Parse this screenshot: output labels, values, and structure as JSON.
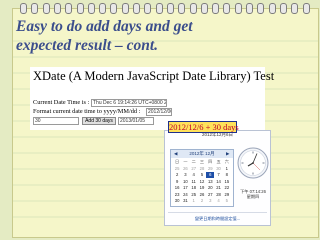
{
  "slide": {
    "title_line1": "Easy to do add days and get",
    "title_line2": "expected result – cont."
  },
  "app": {
    "heading": "XDate (A Modern JavaScript Date Library) Test",
    "current_time_label": "Current Date Time is :",
    "current_time_value": "Thu Dec 6 19:14:26 UTC+0800 2012",
    "format_label": "Format current date time to yyyy/MM/dd :",
    "format_value": "2012/12/06",
    "days_input_value": "30",
    "add_button_label": "Add 30 days",
    "result_value": "2013/01/05"
  },
  "callout": {
    "text": "2012/12/6 + 30 days"
  },
  "widget": {
    "title": "2012年12月6日",
    "calendar_month": "2012年 12月",
    "prev_label": "◀",
    "next_label": "▶",
    "weekdays": [
      "日",
      "一",
      "二",
      "三",
      "四",
      "五",
      "六"
    ],
    "days": [
      {
        "d": "25",
        "t": "other"
      },
      {
        "d": "26",
        "t": "other"
      },
      {
        "d": "27",
        "t": "other"
      },
      {
        "d": "28",
        "t": "other"
      },
      {
        "d": "29",
        "t": "other"
      },
      {
        "d": "30",
        "t": "other"
      },
      {
        "d": "1",
        "t": ""
      },
      {
        "d": "2",
        "t": ""
      },
      {
        "d": "3",
        "t": ""
      },
      {
        "d": "4",
        "t": ""
      },
      {
        "d": "5",
        "t": ""
      },
      {
        "d": "6",
        "t": "today"
      },
      {
        "d": "7",
        "t": ""
      },
      {
        "d": "8",
        "t": ""
      },
      {
        "d": "9",
        "t": ""
      },
      {
        "d": "10",
        "t": ""
      },
      {
        "d": "11",
        "t": ""
      },
      {
        "d": "12",
        "t": ""
      },
      {
        "d": "13",
        "t": ""
      },
      {
        "d": "14",
        "t": ""
      },
      {
        "d": "15",
        "t": ""
      },
      {
        "d": "16",
        "t": ""
      },
      {
        "d": "17",
        "t": ""
      },
      {
        "d": "18",
        "t": ""
      },
      {
        "d": "19",
        "t": ""
      },
      {
        "d": "20",
        "t": ""
      },
      {
        "d": "21",
        "t": ""
      },
      {
        "d": "22",
        "t": ""
      },
      {
        "d": "23",
        "t": ""
      },
      {
        "d": "24",
        "t": ""
      },
      {
        "d": "25",
        "t": ""
      },
      {
        "d": "26",
        "t": ""
      },
      {
        "d": "27",
        "t": ""
      },
      {
        "d": "28",
        "t": ""
      },
      {
        "d": "29",
        "t": ""
      },
      {
        "d": "30",
        "t": ""
      },
      {
        "d": "31",
        "t": ""
      },
      {
        "d": "1",
        "t": "other"
      },
      {
        "d": "2",
        "t": "other"
      },
      {
        "d": "3",
        "t": "other"
      },
      {
        "d": "4",
        "t": "other"
      },
      {
        "d": "5",
        "t": "other"
      }
    ],
    "time_text": "下午 07:14:26",
    "weekday_text": "星期四",
    "bottom_link": "變更日期和時間設定值..."
  },
  "colors": {
    "title": "#3b4e8c",
    "callout_bg": "#ffe15a",
    "callout_text": "#c0002a",
    "today": "#1e4fa8"
  }
}
